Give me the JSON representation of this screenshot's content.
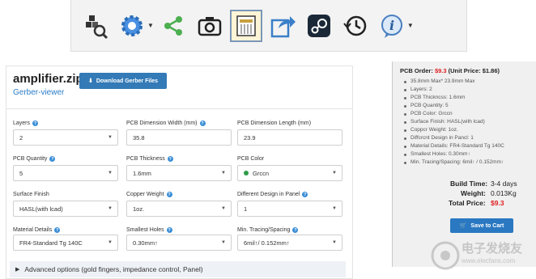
{
  "toolbar": {
    "icons": [
      "component-search-icon",
      "gear-icon",
      "share-icon",
      "camera-icon",
      "pcb-view-icon",
      "export-icon",
      "steam-icon",
      "history-icon",
      "info-icon"
    ]
  },
  "file": {
    "title": "amplifier.zip",
    "viewer_link": "Gerber-viewer",
    "download_label": "Download Gerber Files"
  },
  "fields": {
    "layers": {
      "label": "Layers",
      "value": "2"
    },
    "dim_width": {
      "label": "PCB Dimension Width (mm)",
      "value": "35.8"
    },
    "dim_length": {
      "label": "PCB Dimension Length (mm)",
      "value": "23.9"
    },
    "quantity": {
      "label": "PCB Quantity",
      "value": "5"
    },
    "thickness": {
      "label": "PCB Thickness",
      "value": "1.6mm"
    },
    "color": {
      "label": "PCB Color",
      "value": "Grccn"
    },
    "surface": {
      "label": "Surface Finish",
      "value": "HASL(with lcad)"
    },
    "copper": {
      "label": "Copper Weight",
      "value": "1oz."
    },
    "panel": {
      "label": "Different Design in Panel",
      "value": "1"
    },
    "material": {
      "label": "Material Details",
      "value": "FR4-Standard Tg 140C"
    },
    "holes": {
      "label": "Smallest Holes",
      "value": "0.30mm↑"
    },
    "tracing": {
      "label": "Min. Tracing/Spacing",
      "value": "6mil↑/ 0.152mm↑"
    }
  },
  "advanced_label": "Advanced options (gold fingers, impedance control, Panel)",
  "order": {
    "label": "PCB Order:",
    "price": "$9.3",
    "unit_price": "(Unit Price: $1.86)",
    "specs": [
      "35.8mm Max* 23.9mm Max",
      "Layers: 2",
      "PCB Thickncss: 1.6mm",
      "PCB Quantity: 5",
      "PCB Color: Grccn",
      "Surface Finish: HASL(with lcad)",
      "Coppcr Weight: 1oz.",
      "Diffcrcnt Design in Pancl: 1",
      "Material Details: FR4-Standard Tg 140C",
      "Smallest Holes: 0.30mm↑",
      "Min. Tracing/Spacing: 6mil↑ / 0.152mm↑"
    ],
    "build_time_label": "Build Time:",
    "build_time": "3-4 days",
    "weight_label": "Weight:",
    "weight": "0.013Kg",
    "total_label": "Total Price:",
    "total": "$9.3",
    "cart_label": "Save to Cart"
  },
  "watermark": {
    "line1": "电子发烧友",
    "line2": "www.elecfans.com"
  },
  "colors": {
    "accent": "#337ab7",
    "price_red": "#e02020",
    "green": "#2e9b47"
  }
}
